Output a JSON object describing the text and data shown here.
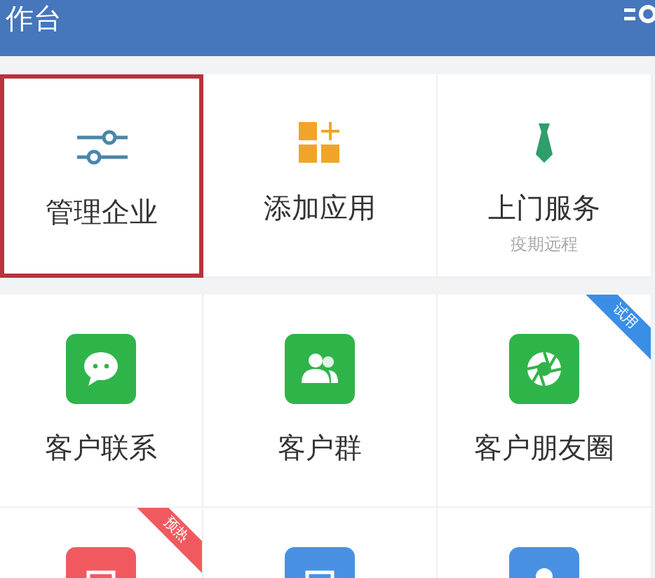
{
  "header": {
    "title": "作台"
  },
  "sections": [
    {
      "items": [
        {
          "label": "管理企业",
          "selected": true
        },
        {
          "label": "添加应用",
          "selected": false
        },
        {
          "label": "上门服务",
          "sublabel": "疫期远程",
          "selected": false
        }
      ]
    },
    {
      "items": [
        {
          "label": "客户联系",
          "color": "#2fb44a",
          "selected": false
        },
        {
          "label": "客户群",
          "color": "#2fb44a",
          "selected": false
        },
        {
          "label": "客户朋友圈",
          "color": "#2fb44a",
          "selected": false,
          "ribbon": {
            "text": "试用",
            "color": "#3a8ee6"
          }
        },
        {
          "color": "#f05a5f",
          "selected": false,
          "ribbon": {
            "text": "预热",
            "color": "#f05a5f"
          }
        },
        {
          "color": "#4a90e2",
          "selected": false
        },
        {
          "color": "#4a90e2",
          "selected": false
        }
      ]
    }
  ]
}
